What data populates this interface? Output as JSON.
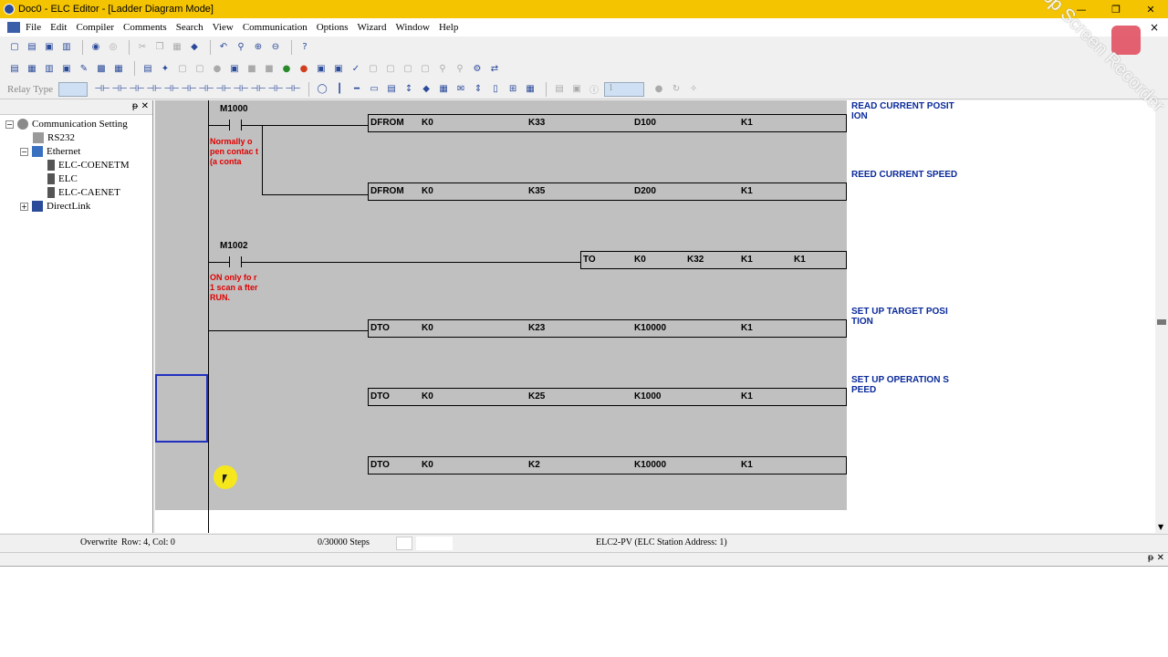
{
  "window": {
    "title": "Doc0 - ELC Editor - [Ladder Diagram Mode]",
    "minimize": "—",
    "maximize": "❐",
    "close": "✕"
  },
  "menu": [
    "File",
    "Edit",
    "Compiler",
    "Comments",
    "Search",
    "View",
    "Communication",
    "Options",
    "Wizard",
    "Window",
    "Help"
  ],
  "menu_close": "×",
  "toolbar": {
    "relay_type_label": "Relay Type",
    "spin_value": "1"
  },
  "tree": {
    "root": "Communication Setting",
    "rs232": "RS232",
    "ethernet": "Ethernet",
    "eth_children": [
      "ELC-COENETM",
      "ELC",
      "ELC-CAENET"
    ],
    "directlink": "DirectLink",
    "panel_buttons": "ᵽ ✕"
  },
  "ladder": {
    "contact1": "M1000",
    "comment1": "Normally o pen contac t (a conta",
    "contact2": "M1002",
    "comment2": "ON only fo r 1 scan a fter RUN.",
    "rows": [
      {
        "op": "DFROM",
        "a": "K0",
        "b": "K33",
        "c": "D100",
        "d": "K1",
        "e": ""
      },
      {
        "op": "DFROM",
        "a": "K0",
        "b": "K35",
        "c": "D200",
        "d": "K1",
        "e": ""
      },
      {
        "op": "TO",
        "a": "K0",
        "b": "K32",
        "c": "K1",
        "d": "K1",
        "e": ""
      },
      {
        "op": "DTO",
        "a": "K0",
        "b": "K23",
        "c": "K10000",
        "d": "K1",
        "e": ""
      },
      {
        "op": "DTO",
        "a": "K0",
        "b": "K25",
        "c": "K1000",
        "d": "K1",
        "e": ""
      },
      {
        "op": "DTO",
        "a": "K0",
        "b": "K2",
        "c": "K10000",
        "d": "K1",
        "e": ""
      }
    ],
    "comments": [
      "READ CURRENT POSIT ION",
      "REED CURRENT SPEED",
      "SET UP TARGET POSI TION",
      "SET UP OPERATION S PEED"
    ]
  },
  "status": {
    "mode": "Overwrite",
    "position": "Row: 4, Col: 0",
    "steps": "0/30000 Steps",
    "station": "ELC2-PV (ELC Station Address: 1)"
  },
  "watermark": "iTop Screen Recorder"
}
